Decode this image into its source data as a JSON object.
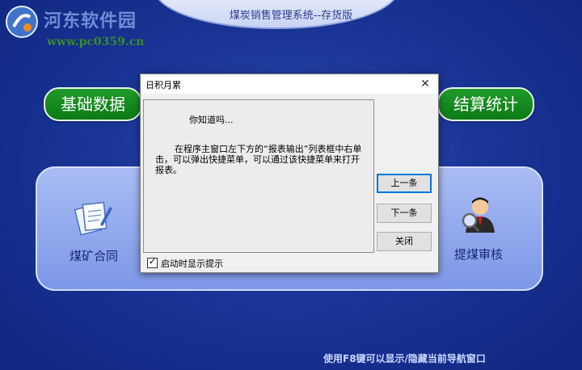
{
  "app": {
    "title": "煤炭销售管理系统--存货版"
  },
  "watermark": {
    "name": "河东软件园",
    "url": "www.pc0359.cn"
  },
  "nav": {
    "left_pill": "基础数据",
    "right_pill": "结算统计"
  },
  "modules": [
    {
      "label": "煤矿合同",
      "icon": "documents-icon"
    },
    {
      "label": "提煤审核",
      "icon": "user-search-icon"
    }
  ],
  "footer": {
    "hint": "使用F8键可以显示/隐藏当前导航窗口"
  },
  "dialog": {
    "title": "日积月累",
    "close_glyph": "✕",
    "tip_heading": "你知道吗...",
    "tip_body": "在程序主窗口左下方的“报表输出”列表框中右单击，可以弹出快捷菜单，可以通过该快捷菜单来打开报表。",
    "buttons": {
      "prev": "上一条",
      "next": "下一条",
      "close": "关闭"
    },
    "checkbox": {
      "label": "启动时显示提示",
      "checked": true
    }
  },
  "colors": {
    "background": "#1a3596",
    "pill": "#0d7a17",
    "panel": "#94aaee"
  }
}
